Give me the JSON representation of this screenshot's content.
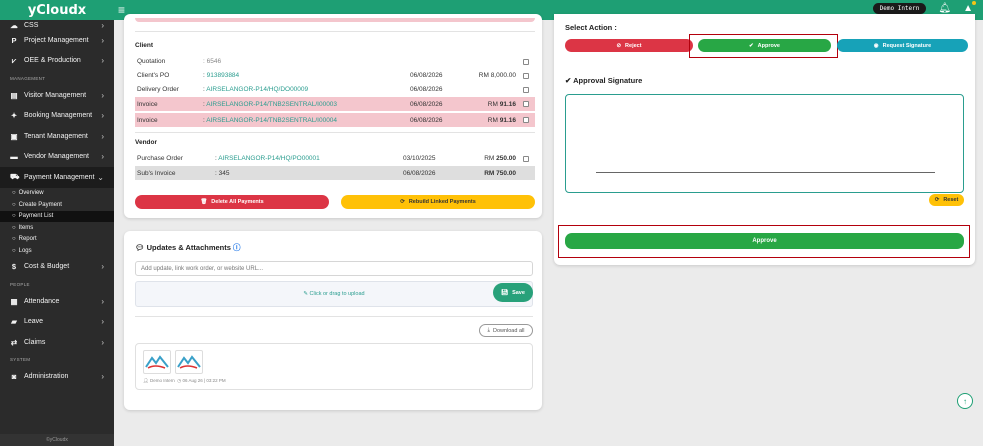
{
  "app": {
    "brand": "yCloudx",
    "user": "Demo Intern"
  },
  "sidebar": {
    "top_items": [
      {
        "label": "CSS",
        "icon": "cloud-icon"
      },
      {
        "label": "Project Management",
        "icon": "p-icon"
      },
      {
        "label": "OEE & Production",
        "icon": "chart-icon"
      }
    ],
    "section_management": "MANAGEMENT",
    "mgmt_items": [
      {
        "label": "Visitor Management"
      },
      {
        "label": "Booking Management"
      },
      {
        "label": "Tenant Management"
      },
      {
        "label": "Vendor Management"
      },
      {
        "label": "Payment Management"
      }
    ],
    "payment_subitems": [
      "Overview",
      "Create Payment",
      "Payment List",
      "Items",
      "Report",
      "Logs"
    ],
    "cost_budget": "Cost & Budget",
    "section_people": "PEOPLE",
    "people_items": [
      {
        "label": "Attendance"
      },
      {
        "label": "Leave"
      },
      {
        "label": "Claims"
      }
    ],
    "section_system": "SYSTEM",
    "system_items": [
      {
        "label": "Administration"
      }
    ],
    "footer": "©yCloudx"
  },
  "client": {
    "title": "Client",
    "rows": [
      {
        "label": "Quotation",
        "ref": "6546",
        "date": "",
        "amount": ""
      },
      {
        "label": "Client's PO",
        "ref": "913893884",
        "date": "06/08/2026",
        "amount": "RM 8,000.00"
      },
      {
        "label": "Delivery Order",
        "ref": "AIRSELANGOR-P14/HQ/DO00009",
        "date": "06/08/2026",
        "amount": ""
      },
      {
        "label": "Invoice",
        "ref": "AIRSELANGOR-P14/TNB2SENTRAL/I00003",
        "date": "06/08/2026",
        "amount_prefix": "RM",
        "amount_value": "91.16"
      },
      {
        "label": "Invoice",
        "ref": "AIRSELANGOR-P14/TNB2SENTRAL/I00004",
        "date": "06/08/2026",
        "amount_prefix": "RM",
        "amount_value": "91.16"
      }
    ]
  },
  "vendor": {
    "title": "Vendor",
    "rows": [
      {
        "label": "Purchase Order",
        "ref": "AIRSELANGOR-P14/HQ/PO00001",
        "date": "03/10/2025",
        "amount_prefix": "RM",
        "amount_value": "250.00"
      },
      {
        "label": "Sub's Invoice",
        "ref": "345",
        "date": "06/08/2026",
        "amount": "RM 750.00"
      }
    ]
  },
  "actions": {
    "delete_all": "Delete All Payments",
    "rebuild": "Rebuild Linked Payments"
  },
  "updates": {
    "title": "Updates & Attachments",
    "placeholder": "Add update, link work order, or website URL...",
    "drop_text": "Click or drag to upload",
    "save": "Save",
    "download_all": "Download all",
    "meta_user": "Demo Intern",
    "meta_time": "06 Aug 26 | 03:22 PM"
  },
  "approval": {
    "select_action": "Select Action :",
    "reject": "Reject",
    "approve": "Approve",
    "request_signature": "Request Signature",
    "signature_title": "Approval Signature",
    "reset": "Reset",
    "approve_main": "Approve"
  },
  "colors": {
    "brand": "#1e9f74",
    "danger": "#dc3545",
    "warning": "#ffc107",
    "success": "#28a745",
    "info": "#17a2b8"
  }
}
